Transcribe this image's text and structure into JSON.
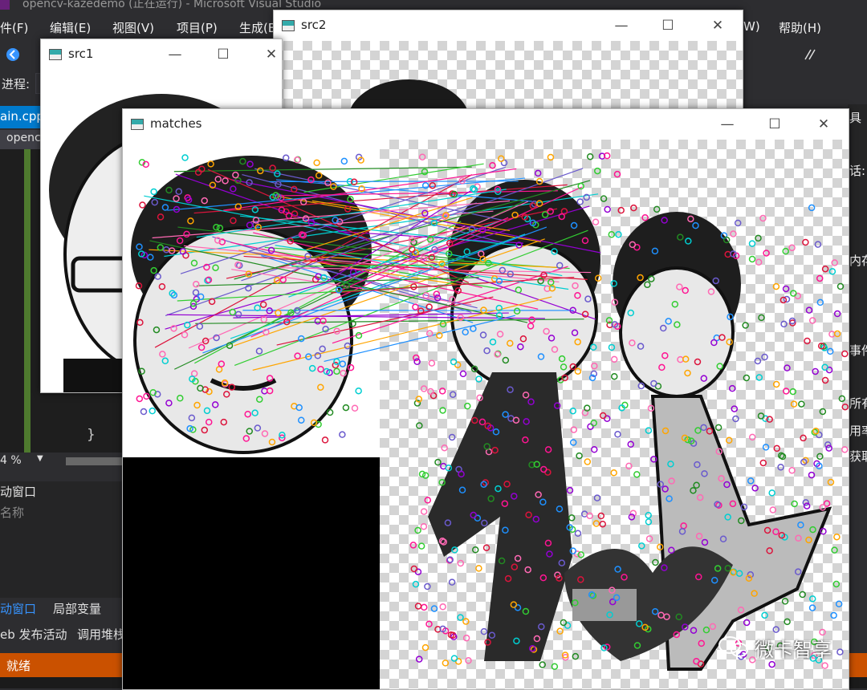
{
  "vs": {
    "window_title": "opencv-kazedemo (正在运行) - Microsoft Visual Studio",
    "menu": [
      "件(F)",
      "编辑(E)",
      "视图(V)",
      "项目(P)",
      "生成(B",
      "W)",
      "帮助(H)"
    ],
    "process_label": "进程:",
    "file_tab": "ain.cpp",
    "solution_item": "openc",
    "brace": "}",
    "zoom": "4 %",
    "autos_title": "动窗口",
    "autos_col": "名称",
    "bottom_tabs": [
      "动窗口",
      "局部变量"
    ],
    "bottom_tabs2": [
      "eb 发布活动",
      "调用堆栈"
    ],
    "status": "就绪",
    "right_panel": [
      "具",
      "话:",
      "内存",
      "事件",
      "所有事",
      "用率",
      "获取"
    ]
  },
  "windows": {
    "src1": {
      "title": "src1",
      "min": "—",
      "max": "☐",
      "close": "✕"
    },
    "src2": {
      "title": "src2",
      "min": "—",
      "max": "☐",
      "close": "✕"
    },
    "matches": {
      "title": "matches",
      "min": "—",
      "max": "☐",
      "close": "✕"
    }
  },
  "watermark": "微卡智享",
  "colors": {
    "vs_bg": "#2d2d30",
    "status_bar": "#ca5100",
    "accent": "#007acc"
  }
}
